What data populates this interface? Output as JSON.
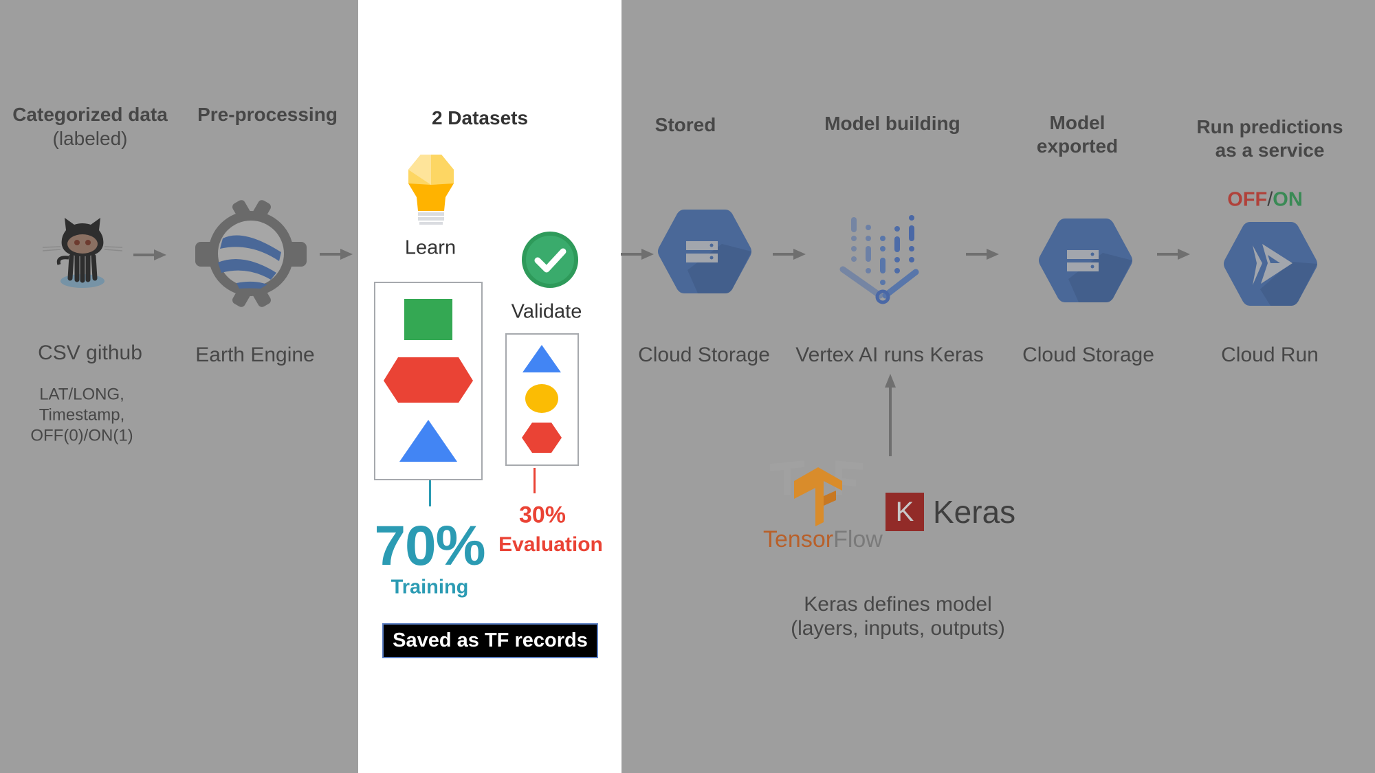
{
  "pipeline": {
    "steps": [
      {
        "title": "Categorized data",
        "subtitle": "(labeled)",
        "icon": "github-octocat-icon",
        "label": "CSV github",
        "details": [
          "LAT/LONG,",
          "Timestamp,",
          "OFF(0)/ON(1)"
        ]
      },
      {
        "title": "Pre-processing",
        "icon": "earth-engine-icon",
        "label": "Earth Engine"
      },
      {
        "title": "Stored",
        "icon": "cloud-storage-icon",
        "label": "Cloud Storage"
      },
      {
        "title": "Model building",
        "icon": "vertex-ai-icon",
        "label": "Vertex AI runs Keras"
      },
      {
        "title_lines": [
          "Model",
          "exported"
        ],
        "icon": "cloud-storage-icon",
        "label": "Cloud Storage"
      },
      {
        "title_lines": [
          "Run predictions",
          "as a service"
        ],
        "icon": "cloud-run-icon",
        "label": "Cloud Run",
        "status": {
          "off": "OFF",
          "sep": "/",
          "on": "ON"
        }
      }
    ]
  },
  "datasets": {
    "title": "2 Datasets",
    "learn": {
      "label": "Learn",
      "icon": "lightbulb-icon",
      "shapes": [
        "square",
        "hexagon",
        "triangle"
      ],
      "percent": "70%",
      "name": "Training"
    },
    "validate": {
      "label": "Validate",
      "icon": "checkmark-circle-icon",
      "shapes": [
        "triangle",
        "circle",
        "hexagon"
      ],
      "percent": "30%",
      "name": "Evaluation"
    },
    "footer": "Saved as TF records"
  },
  "frameworks": {
    "tensorflow": {
      "tensor": "Tensor",
      "flow": "Flow"
    },
    "keras": {
      "letter": "K",
      "name": "Keras"
    },
    "caption": [
      "Keras defines model",
      "(layers, inputs, outputs)"
    ]
  },
  "colors": {
    "background": "#9e9e9e",
    "panel": "#ffffff",
    "training": "#2b9bb3",
    "evaluation": "#ea4335",
    "green": "#34a853",
    "blue": "#4285f4",
    "yellow": "#fbbc04",
    "gcp_blue_dim": "#4a6898",
    "off": "#b0413a",
    "on": "#3a8a55"
  }
}
